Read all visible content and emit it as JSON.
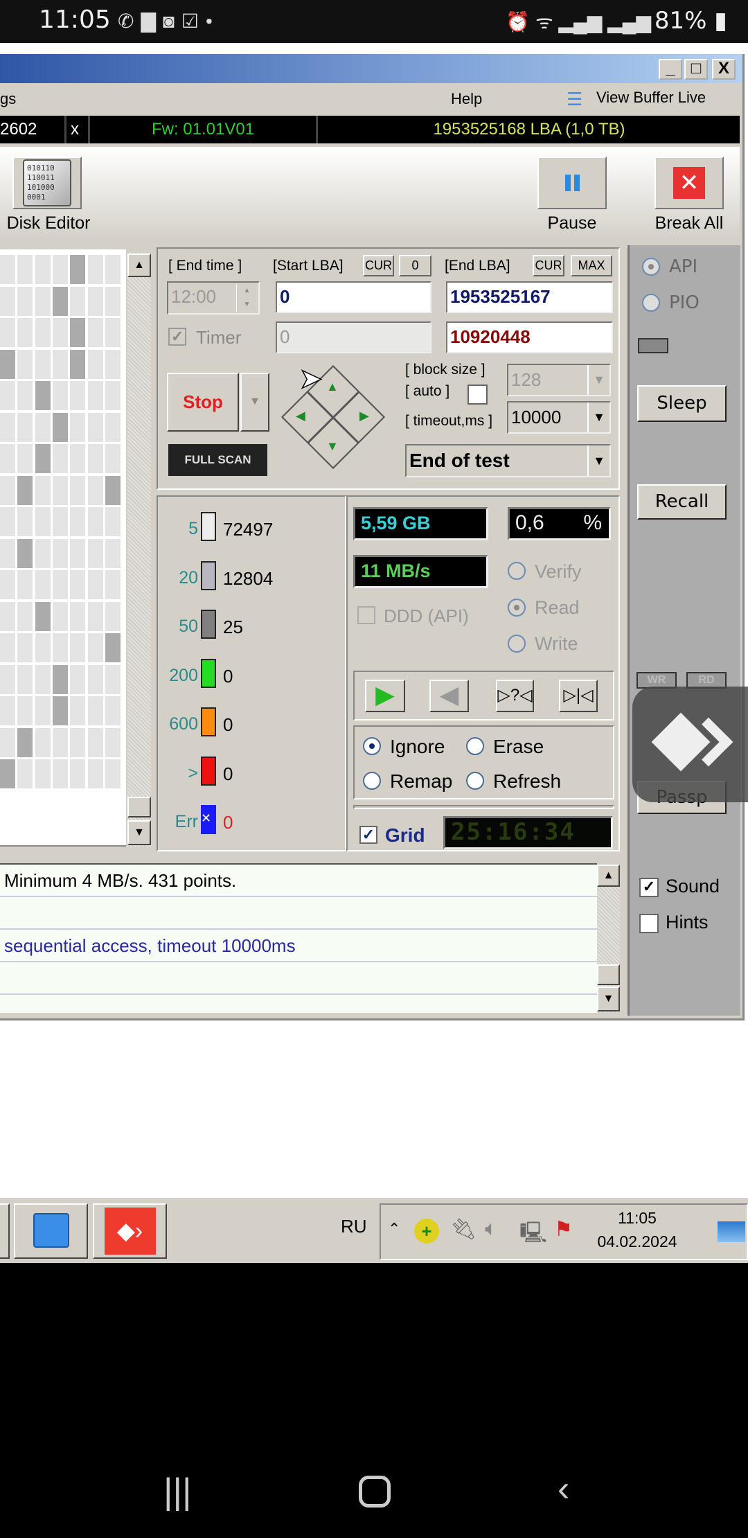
{
  "status_bar": {
    "time": "11:05",
    "battery": "81%",
    "icons": [
      "viber-icon",
      "folder-icon",
      "clock-app-icon",
      "checklist-icon",
      "key-icon"
    ],
    "right_icons": [
      "alarm-icon",
      "wifi-icon",
      "signal-icon",
      "signal-icon",
      "battery-icon"
    ]
  },
  "window": {
    "controls": {
      "minimize": "_",
      "maximize": "□",
      "close": "X"
    },
    "menu": {
      "partial_item": "gs",
      "help": "Help",
      "view_buffer": "View Buffer Live"
    },
    "info": {
      "serial_tail": "2602",
      "close_x": "x",
      "firmware": "Fw: 01.01V01",
      "capacity": "1953525168 LBA (1,0 TB)"
    },
    "toolbar": {
      "disk_editor": "Disk Editor",
      "pause": "Pause",
      "break_all": "Break All",
      "disk_editor_icon_text": [
        "010110",
        "110011",
        "101000",
        "0001"
      ]
    }
  },
  "scan_map": [
    "0000100",
    "0001000",
    "0000100",
    "1000100",
    "0010000",
    "0001000",
    "0010000",
    "0100001",
    "0000000",
    "0100000",
    "0000000",
    "0010000",
    "0000001",
    "0001000",
    "0001000",
    "0100000",
    "1000000"
  ],
  "controls": {
    "end_time_label": "[ End time ]",
    "start_lba_label": "[Start LBA]",
    "cur_label": "CUR",
    "zero_label": "0",
    "end_lba_label": "[End LBA]",
    "max_label": "MAX",
    "end_time_value": "12:00",
    "start_lba_value": "0",
    "end_lba_value": "1953525167",
    "timer_label": "Timer",
    "timer_checked": true,
    "timer_field_value": "0",
    "current_lba_value": "10920448",
    "stop_label": "Stop",
    "full_scan_label": "FULL SCAN",
    "block_size_label": "[ block size ]",
    "auto_label": "[ auto ]",
    "block_size_value": "128",
    "timeout_label": "[ timeout,ms ]",
    "timeout_value": "10000",
    "end_action_value": "End of test"
  },
  "legend": [
    {
      "label": "5",
      "count": "72497",
      "color": "#ececec"
    },
    {
      "label": "20",
      "count": "12804",
      "color": "#b8b6c0"
    },
    {
      "label": "50",
      "count": "25",
      "color": "#808080"
    },
    {
      "label": "200",
      "count": "0",
      "color": "#22dd22"
    },
    {
      "label": "600",
      "count": "0",
      "color": "#ff8a10"
    },
    {
      "label": ">",
      "count": "0",
      "color": "#ee1111"
    },
    {
      "label": "Err",
      "count": "0",
      "color": "#1a1aff"
    }
  ],
  "stats": {
    "scanned": "5,59 GB",
    "percent": "0,6",
    "percent_sign": "%",
    "speed": "11 MB/s",
    "ddd_label": "DDD (API)",
    "elapsed": "25:16:34",
    "grid_label": "Grid",
    "grid_checked": true
  },
  "mode": {
    "verify": "Verify",
    "read": "Read",
    "write": "Write",
    "selected": "Read"
  },
  "playback": {
    "play": "play-forward-icon",
    "reverse": "play-reverse-icon",
    "butterfly_q": "▷?◁",
    "butterfly": "▷|◁"
  },
  "repair": {
    "ignore": "Ignore",
    "erase": "Erase",
    "remap": "Remap",
    "refresh": "Refresh",
    "selected": "Ignore"
  },
  "sidebar": {
    "api": "API",
    "pio": "PIO",
    "selected": "API",
    "sleep": "Sleep",
    "recall": "Recall",
    "wr": "WR",
    "rd": "RD",
    "passp": "Passp",
    "sound": "Sound",
    "sound_checked": true,
    "hints": "Hints",
    "hints_checked": false
  },
  "log": {
    "rows": [
      "Minimum 4 MB/s. 431 points.",
      "",
      "sequential access, timeout 10000ms",
      "",
      ""
    ]
  },
  "taskbar": {
    "lang": "RU",
    "clock_time": "11:05",
    "clock_date": "04.02.2024"
  },
  "colors": {
    "window_bg": "#d4d0c8",
    "sidebar_bg": "#acacac",
    "firmware": "#33cc33",
    "capacity": "#d8e060",
    "end_lba": "#101a6a",
    "current_lba": "#8a0a0a",
    "stop": "#e02020",
    "anydesk": "#ef3b2d"
  }
}
